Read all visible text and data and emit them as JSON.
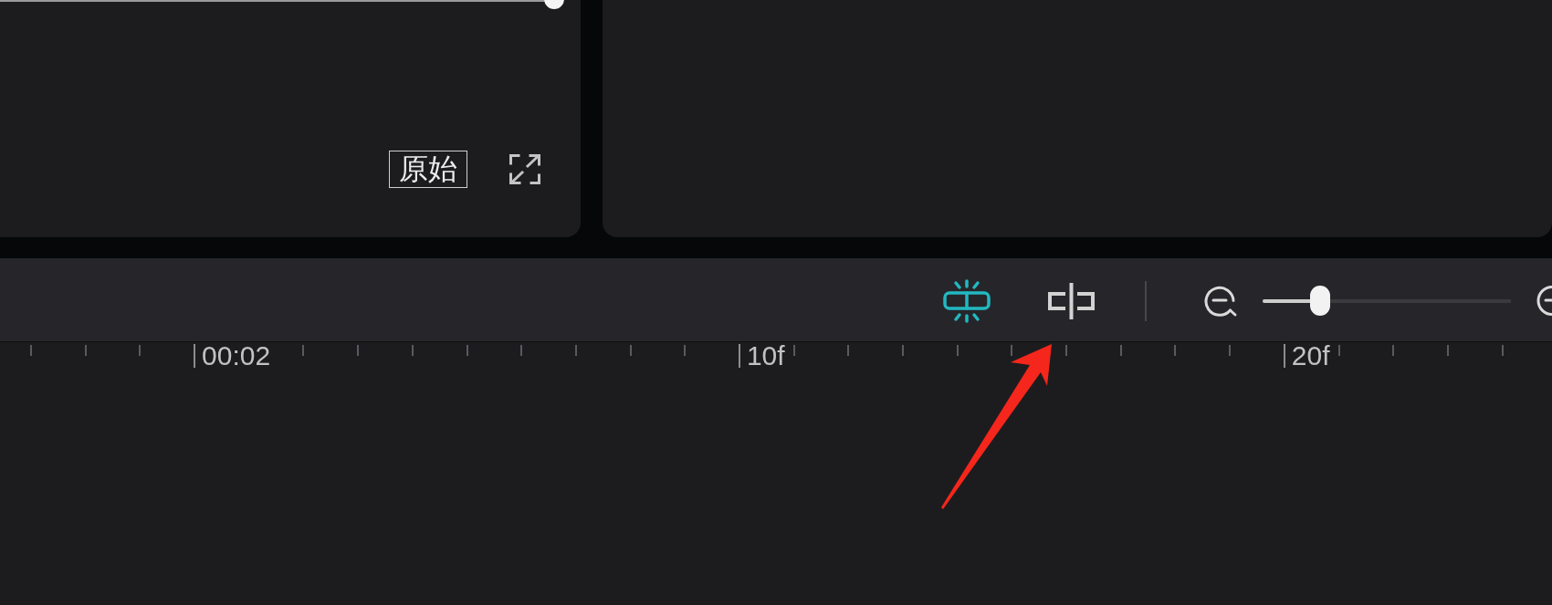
{
  "preview": {
    "progress": {
      "level": 0.955
    },
    "ratio_label": "原始"
  },
  "toolbar": {
    "tools": [
      {
        "kind": "snap",
        "on": true
      },
      {
        "kind": "split",
        "on": false
      }
    ],
    "zoom": {
      "level": 0.23
    }
  },
  "ruler": {
    "labels": [
      "00:02",
      "10f",
      "20f"
    ]
  },
  "annotations": [
    {
      "kind": "arrow"
    }
  ]
}
